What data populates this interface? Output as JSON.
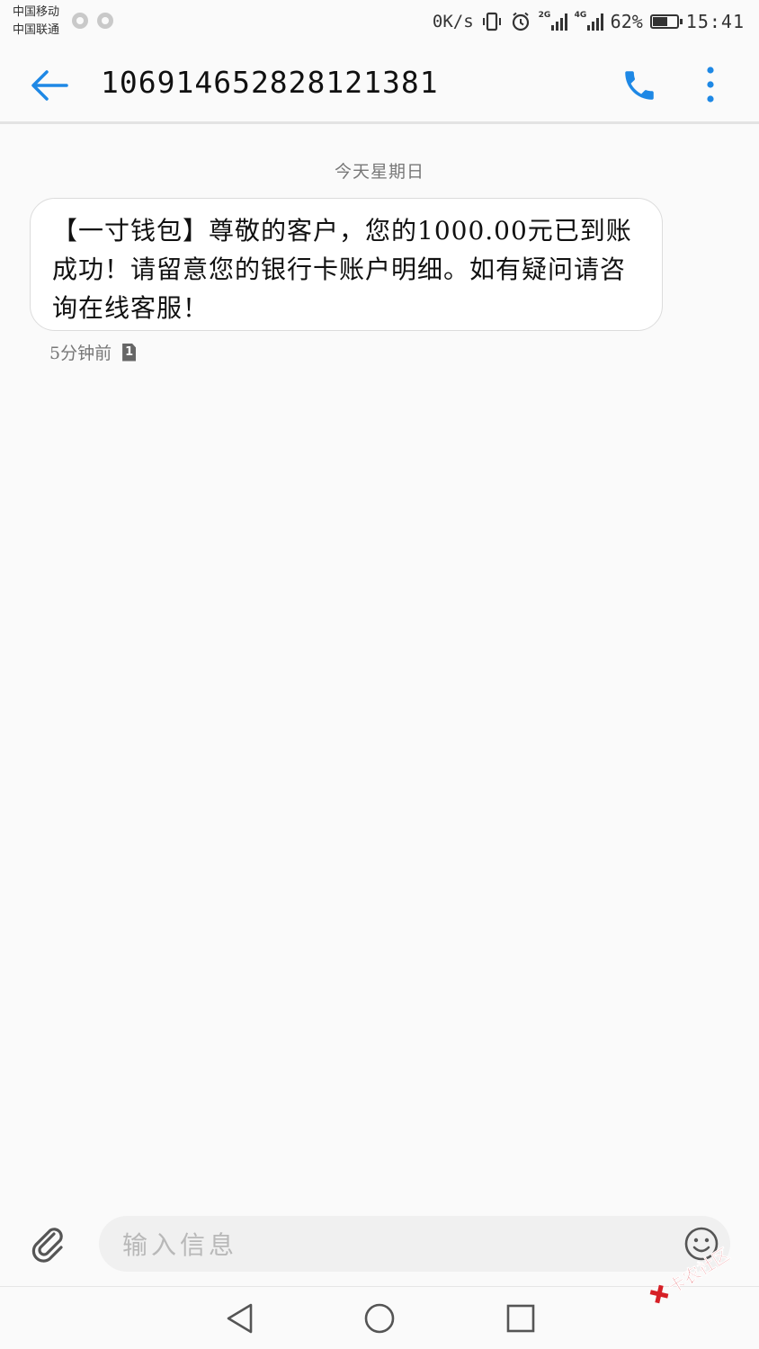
{
  "status_bar": {
    "carrier_1": "中国移动",
    "carrier_2": "中国联通",
    "net_speed": "0K/s",
    "signal_1_tag": "2G",
    "signal_2_tag": "4G",
    "battery_percent": "62%",
    "battery_level": 0.62,
    "time": "15:41"
  },
  "header": {
    "contact_number": "10691465282812138 1"
  },
  "conversation": {
    "date_divider": "今天星期日",
    "messages": [
      {
        "text": "【一寸钱包】尊敬的客户，您的1000.00元已到账成功！请留意您的银行卡账户明细。如有疑问请咨询在线客服！",
        "time": "5分钟前",
        "sim": "1"
      }
    ]
  },
  "compose": {
    "placeholder": "输入信息"
  },
  "watermark": {
    "text": "卡农社区"
  },
  "colors": {
    "accent": "#1e88e5",
    "background": "#fafafa",
    "watermark": "#d61f26"
  },
  "icons": {
    "back": "arrow-left-icon",
    "call": "phone-icon",
    "more": "more-vertical-icon",
    "attach": "paperclip-icon",
    "emoji": "smiley-icon",
    "sim": "sim-card-icon"
  }
}
